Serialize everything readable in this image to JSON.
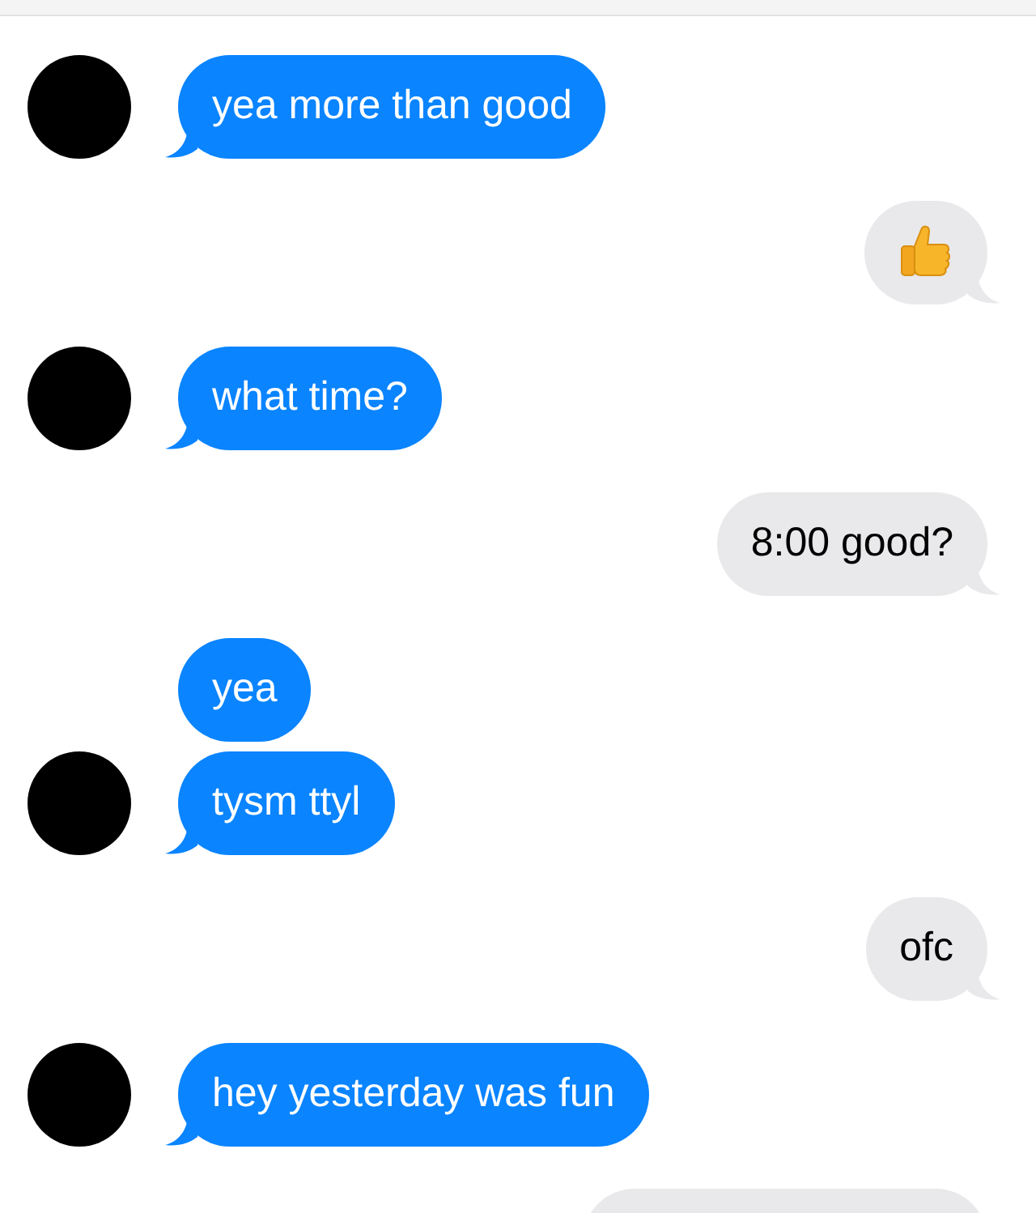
{
  "messages": [
    {
      "outgoing": false,
      "kind": "text",
      "text": "yea more than good",
      "tail": true
    },
    {
      "outgoing": true,
      "kind": "thumbs-up",
      "tail": true
    },
    {
      "outgoing": false,
      "kind": "text",
      "text": "what time?",
      "tail": true
    },
    {
      "outgoing": true,
      "kind": "text",
      "text": "8:00 good?",
      "tail": true
    },
    {
      "outgoing": false,
      "kind": "text",
      "text": "yea",
      "tail": false
    },
    {
      "outgoing": false,
      "kind": "text",
      "text": "tysm ttyl",
      "tail": true
    },
    {
      "outgoing": true,
      "kind": "text",
      "text": "ofc",
      "tail": true
    },
    {
      "outgoing": false,
      "kind": "text",
      "text": "hey yesterday was fun",
      "tail": true
    },
    {
      "outgoing": true,
      "kind": "empty"
    }
  ]
}
